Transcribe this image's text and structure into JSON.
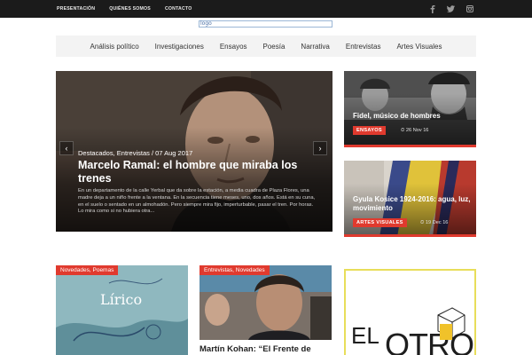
{
  "topbar": {
    "links": [
      "PRESENTACIÓN",
      "QUIÉNES SOMOS",
      "CONTACTO"
    ],
    "social_icons": [
      "facebook-icon",
      "twitter-icon",
      "instagram-icon"
    ]
  },
  "logo": {
    "alt": "logo"
  },
  "nav": {
    "items": [
      "Análisis político",
      "Investigaciones",
      "Ensayos",
      "Poesía",
      "Narrativa",
      "Entrevistas",
      "Artes Visuales"
    ]
  },
  "hero": {
    "meta": "Destacados, Entrevistas / 07 Aug 2017",
    "title": "Marcelo Ramal: el hombre que miraba los trenes",
    "excerpt": "En un departamento de la calle Yerbal que da sobre la estación, a media cuadra de Plaza Flores, una madre deja a un niño frente a la ventana. En la secuencia tiene meses, uno, dos años. Está en su cuna, en el suelo o sentado en un almohadón. Pero siempre mira fijo, imperturbable, pasar el tren. Por horas. Lo mira como si no hubiera otra...",
    "prev_arrow": "‹",
    "next_arrow": "›"
  },
  "side_posts": [
    {
      "title": "Fidel, músico de hombres",
      "badge": "ENSAYOS",
      "date": "26 Nov 16"
    },
    {
      "title": "Gyula Kosice 1924-2016: agua, luz, movimiento",
      "badge": "ARTES VISUALES",
      "date": "19 Dec 16"
    }
  ],
  "cards": [
    {
      "tag": "Novedades, Poemas",
      "image_text": "Lírico",
      "title": ""
    },
    {
      "tag": "Entrevistas, Novedades",
      "title": "Martín Kohan: “El Frente de"
    },
    {
      "ad_text_1": "EL",
      "ad_text_2": "OTRO"
    }
  ],
  "colors": {
    "accent": "#e03a2e",
    "topbar": "#1b1b1b",
    "nav_bg": "#f3f3f3"
  }
}
